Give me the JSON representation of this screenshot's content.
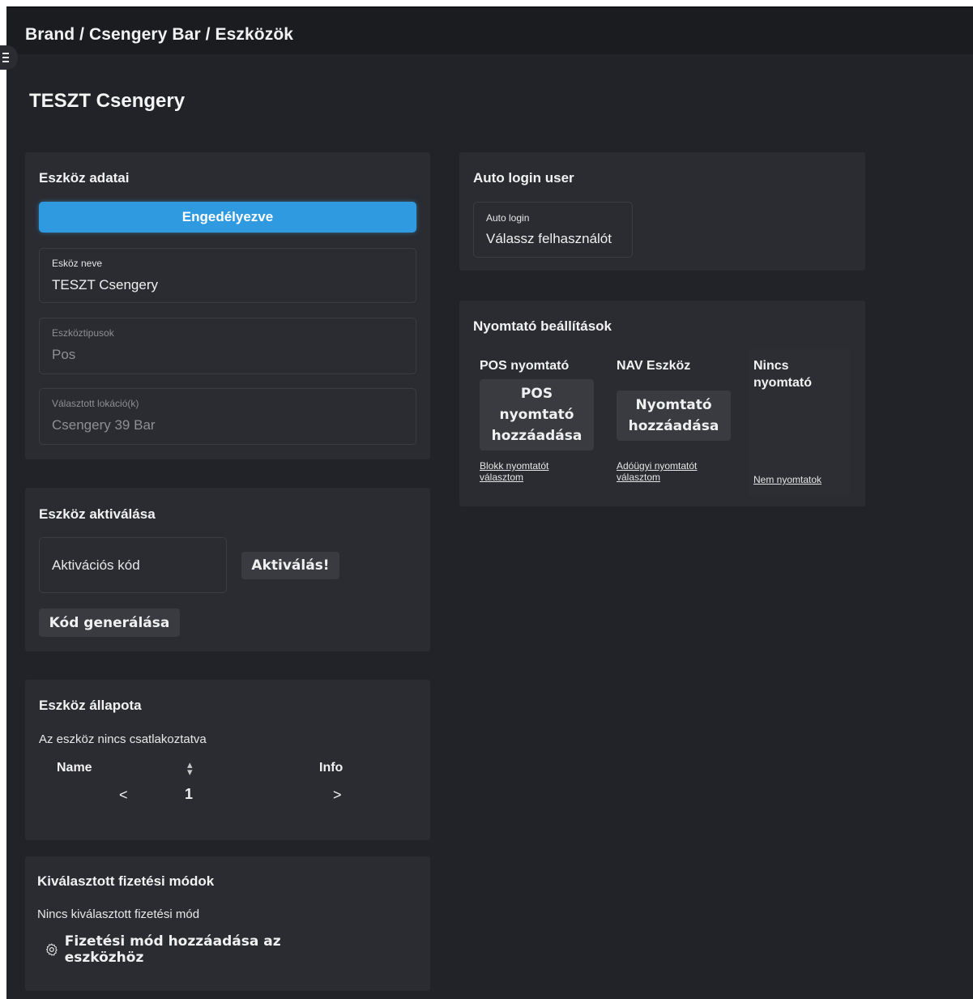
{
  "header": {
    "breadcrumb": "Brand / Csengery Bar / Eszközök",
    "menu_icon": "hamburger-menu-icon"
  },
  "page_title": "TESZT Csengery",
  "device_data": {
    "title": "Eszköz adatai",
    "status_button": "Engedélyezve",
    "name_label": "Esköz neve",
    "name_value": "TESZT Csengery",
    "types_label": "Eszköztipusok",
    "types_value": "Pos",
    "location_label": "Választott lokáció(k)",
    "location_value": "Csengery 39 Bar"
  },
  "activation": {
    "title": "Eszköz aktiválása",
    "code_placeholder": "Aktivációs kód",
    "activate_button": "Aktiválás!",
    "generate_button": "Kód generálása"
  },
  "status": {
    "title": "Eszköz állapota",
    "message": "Az eszköz nincs csatlakoztatva",
    "col_name": "Name",
    "sort_icon": "sort-icon",
    "col_info": "Info",
    "prev": "<",
    "page": "1",
    "next": ">"
  },
  "payment": {
    "title": "Kiválasztott fizetési módok",
    "message": "Nincs kiválasztott fizetési mód",
    "add_button": "Fizetési mód hozzáadása az eszközhöz",
    "add_icon": "gear-icon"
  },
  "auto_login": {
    "title": "Auto login user",
    "field_label": "Auto login",
    "field_value": "Válassz felhasználót"
  },
  "printers": {
    "title": "Nyomtató beállítások",
    "columns": [
      {
        "heading": "POS nyomtató",
        "button": "POS nyomtató hozzáadása",
        "link": "Blokk nyomtatót választom"
      },
      {
        "heading": "NAV Eszköz",
        "button": "Nyomtató hozzáadása",
        "link": "Adóügyi nyomtatót választom"
      },
      {
        "heading": "Nincs nyomtató",
        "button": "",
        "link": "Nem nyomtatok"
      }
    ]
  },
  "colors": {
    "background": "#222328",
    "card": "#2b2c31",
    "accent": "#2f9ae0",
    "button": "#3a3b41"
  }
}
